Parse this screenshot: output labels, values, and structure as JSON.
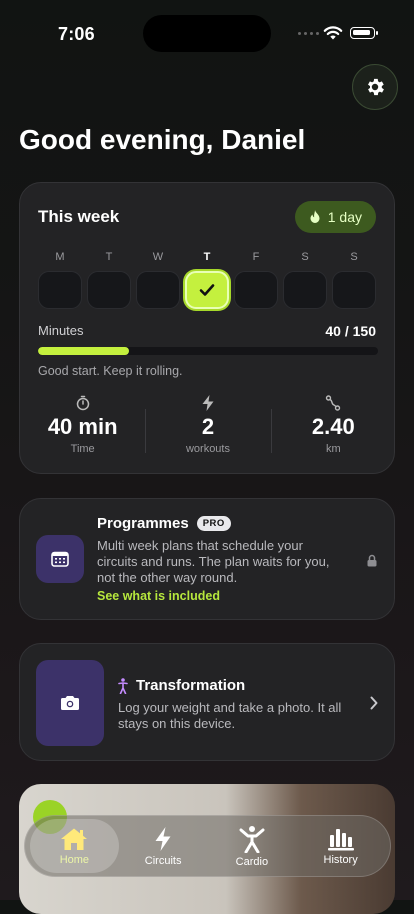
{
  "status_bar": {
    "time": "7:06"
  },
  "header": {
    "greeting": "Good evening, Daniel"
  },
  "week": {
    "title": "This week",
    "streak": "1 day",
    "days": [
      {
        "letter": "M",
        "done": false,
        "today": false
      },
      {
        "letter": "T",
        "done": false,
        "today": false
      },
      {
        "letter": "W",
        "done": false,
        "today": false
      },
      {
        "letter": "T",
        "done": true,
        "today": true
      },
      {
        "letter": "F",
        "done": false,
        "today": false
      },
      {
        "letter": "S",
        "done": false,
        "today": false
      },
      {
        "letter": "S",
        "done": false,
        "today": false
      }
    ],
    "minutes_label": "Minutes",
    "minutes_value": "40 / 150",
    "minutes_progress": 0.2667,
    "encouragement": "Good start. Keep it rolling.",
    "stats": [
      {
        "icon": "stopwatch-icon",
        "value": "40 min",
        "label": "Time"
      },
      {
        "icon": "bolt-icon",
        "value": "2",
        "label": "workouts"
      },
      {
        "icon": "route-icon",
        "value": "2.40",
        "label": "km"
      }
    ]
  },
  "programmes": {
    "title": "Programmes",
    "badge": "PRO",
    "description": "Multi week plans that schedule your circuits and runs. The plan waits for you, not the other way round.",
    "link": "See what is included"
  },
  "transformation": {
    "title": "Transformation",
    "description": "Log your weight and take a photo. It all stays on this device."
  },
  "tabs": [
    {
      "label": "Home",
      "icon": "home-icon",
      "active": true
    },
    {
      "label": "Circuits",
      "icon": "bolt-icon",
      "active": false
    },
    {
      "label": "Cardio",
      "icon": "person-icon",
      "active": false
    },
    {
      "label": "History",
      "icon": "bar-chart-icon",
      "active": false
    }
  ],
  "colors": {
    "accent": "#c4f03e",
    "purple": "#3c3269",
    "streak_bg": "#3d5a1f"
  }
}
